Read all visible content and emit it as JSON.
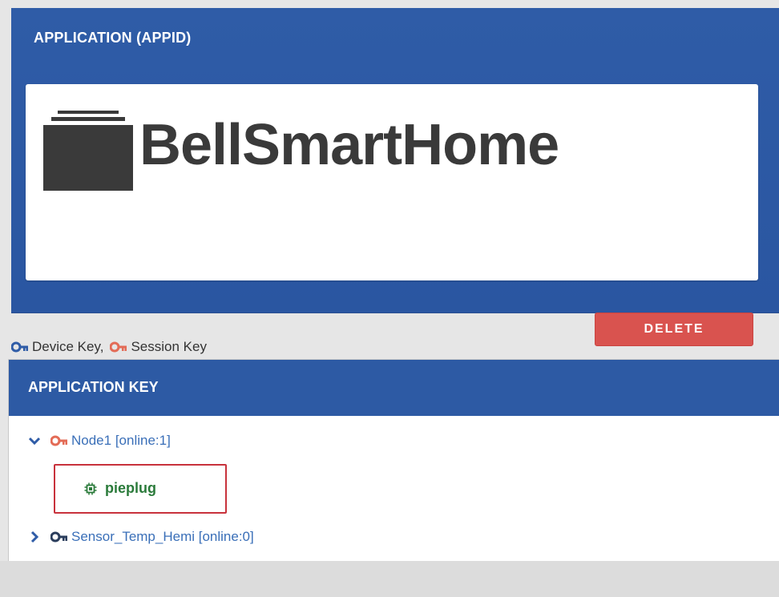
{
  "application_panel": {
    "title": "APPLICATION (APPID)",
    "app_name": "BellSmartHome",
    "delete_label": "DELETE"
  },
  "legend": {
    "device_key": "Device Key,",
    "session_key": "Session Key"
  },
  "application_key_panel": {
    "title": "APPLICATION KEY",
    "nodes": [
      {
        "label": "Node1 [online:1]",
        "expanded": true,
        "key_color": "#e36b56"
      },
      {
        "label": "Sensor_Temp_Hemi [online:0]",
        "expanded": false,
        "key_color": "#2f5ca7"
      }
    ],
    "child": {
      "label": "pieplug"
    }
  },
  "colors": {
    "header_blue": "#2f5ca7",
    "delete_red": "#d9534f",
    "highlight_border": "#c8323c",
    "child_green": "#2a7a3a"
  }
}
